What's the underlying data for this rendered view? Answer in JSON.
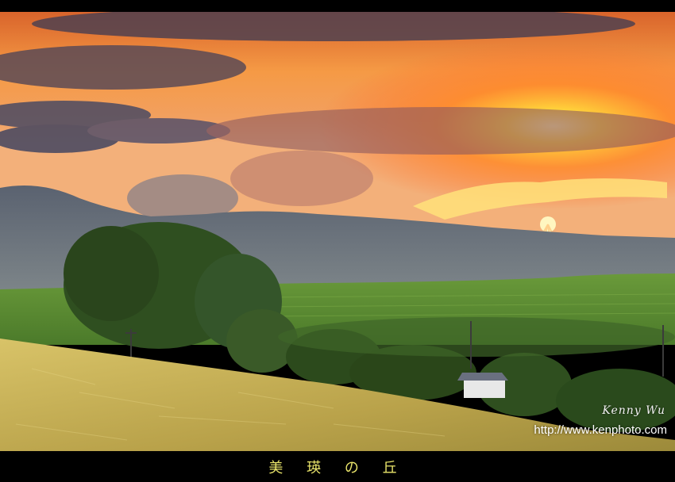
{
  "photo": {
    "subject": "sunset over rolling hills and wheat field",
    "colors": {
      "sky_top": "#e86a2a",
      "sky_glow": "#ffcc33",
      "cloud_dark": "#5b4a55",
      "mountain": "#5f6a77",
      "field_green": "#5a8a2f",
      "wheat": "#c9b45a",
      "tree": "#2c4a1c",
      "frame": "#000000"
    }
  },
  "watermark": {
    "signature": "Kenny Wu",
    "url": "http://www.kenphoto.com"
  },
  "caption": "美 瑛 の 丘"
}
